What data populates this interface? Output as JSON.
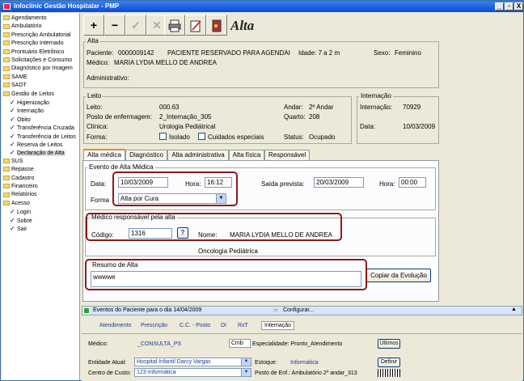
{
  "window": {
    "title": "Infoclinic Gestão Hospitalar - PMP",
    "controls": [
      "_",
      "▫",
      "X"
    ]
  },
  "sidebar": {
    "items": [
      {
        "label": "Agendamento",
        "type": "folder"
      },
      {
        "label": "Ambulatório",
        "type": "folder"
      },
      {
        "label": "Prescrição Ambulatorial",
        "type": "folder"
      },
      {
        "label": "Prescrição Internado",
        "type": "folder"
      },
      {
        "label": "Prontuário Eletrônico",
        "type": "folder"
      },
      {
        "label": "Solicitações e Consumo",
        "type": "folder"
      },
      {
        "label": "Diagnóstico por Imagem",
        "type": "folder"
      },
      {
        "label": "SAME",
        "type": "folder"
      },
      {
        "label": "SADT",
        "type": "folder"
      },
      {
        "label": "Gestão de Leitos",
        "type": "folder"
      },
      {
        "label": "Higienização",
        "type": "check"
      },
      {
        "label": "Internação",
        "type": "check"
      },
      {
        "label": "Óbito",
        "type": "check"
      },
      {
        "label": "Transferência Cruzada",
        "type": "check"
      },
      {
        "label": "Transferência de Leitos",
        "type": "check"
      },
      {
        "label": "Reserva de Leitos",
        "type": "check"
      },
      {
        "label": "Declaração de Alta",
        "type": "check"
      },
      {
        "label": "SUS",
        "type": "folder"
      },
      {
        "label": "Repasse",
        "type": "folder"
      },
      {
        "label": "Cadastro",
        "type": "folder"
      },
      {
        "label": "Financeiro",
        "type": "folder"
      },
      {
        "label": "Relatórios",
        "type": "folder"
      },
      {
        "label": "Acesso",
        "type": "folder"
      },
      {
        "label": "Login",
        "type": "check"
      },
      {
        "label": "Sobre",
        "type": "check"
      },
      {
        "label": "Sair",
        "type": "check"
      }
    ]
  },
  "toolbar": {
    "add": "+",
    "remove": "−",
    "confirm": "✓",
    "cancel": "✕",
    "title": "Alta"
  },
  "alta": {
    "group_label": "Alta",
    "paciente_label": "Paciente:",
    "paciente_id": "0000009142",
    "paciente_nome": "PACIENTE RESERVADO PARA AGENDAI",
    "idade": "Idade: 7 a 2 m",
    "sexo_label": "Sexo:",
    "sexo": "Feminino",
    "medico_label": "Médico:",
    "medico": "MARIA LYDIA MELLO DE ANDREA",
    "administrativo_label": "Administrativo:"
  },
  "leito": {
    "group_label": "Leito",
    "leito_label": "Leito:",
    "leito": "000.63",
    "andar_label": "Andar:",
    "andar": "2º Andar",
    "posto_label": "Posto de enfermagem:",
    "posto": "2_Internação_305",
    "quarto_label": "Quarto:",
    "quarto": "208",
    "clinica_label": "Clínica:",
    "clinica": "Urologia Pediátrical",
    "forma_label": "Forma:",
    "isolado_label": "Isolado",
    "cuidados_label": "Cuidados especiais",
    "status_label": "Status:",
    "status": "Ocupado"
  },
  "internacao": {
    "group_label": "Internação",
    "internacao_label": "Internação:",
    "internacao": "70929",
    "data_label": "Data:",
    "data": "10/03/2009"
  },
  "tabs": [
    {
      "label": "Alta médica",
      "active": true
    },
    {
      "label": "Diagnóstico",
      "active": false
    },
    {
      "label": "Alta administrativa",
      "active": false
    },
    {
      "label": "Alta física",
      "active": false
    },
    {
      "label": "Responsável",
      "active": false
    }
  ],
  "evento": {
    "group_label": "Evento de Alta Médica",
    "data_label": "Data:",
    "data": "10/03/2009",
    "hora_label": "Hora:",
    "hora": "16:12",
    "saida_label": "Saída prevista:",
    "saida": "20/03/2009",
    "hora2_label": "Hora:",
    "hora2": "00:00",
    "forma_label": "Forma",
    "forma": "Alta por Cura"
  },
  "medico_resp": {
    "group_label": "Médico responsável pela alta",
    "codigo_label": "Código:",
    "codigo": "1316",
    "lookup": "?",
    "nome_label": "Nome:",
    "nome": "MARIA LYDIA MELLO DE ANDREA",
    "especialidade": "Oncologia Pediátrica"
  },
  "resumo": {
    "group_label": "Resumo de Alta",
    "texto": "wwwwe",
    "copiar": "Copiar da Evolução"
  },
  "eventos_bar": {
    "text": "Eventos do Paciente para o dia 14/04/2009",
    "configurar": "Configurar..."
  },
  "bottom_tabs": [
    "Atendimento",
    "Prescrição",
    "C.C. - Posto",
    "DI",
    "RxT",
    "Internação"
  ],
  "bottom": {
    "medico_label": "Médico:",
    "medico": "_CONSULTA_PS",
    "cmb": "Cmb",
    "especialidade": "Especialidade: Pronto_Atendimento",
    "ultimos": "Últimos",
    "entidade_label": "Entidade Atual:",
    "entidade": "Hospital Infantil Darcy Vargas",
    "estoque_label": "Estoque:",
    "estoque": "Informática",
    "definir": "Definir",
    "centro_label": "Centro de Custo:",
    "centro": "123-Informática",
    "posto": "Posto de Enf.: Ambulatório 2º andar_313"
  }
}
